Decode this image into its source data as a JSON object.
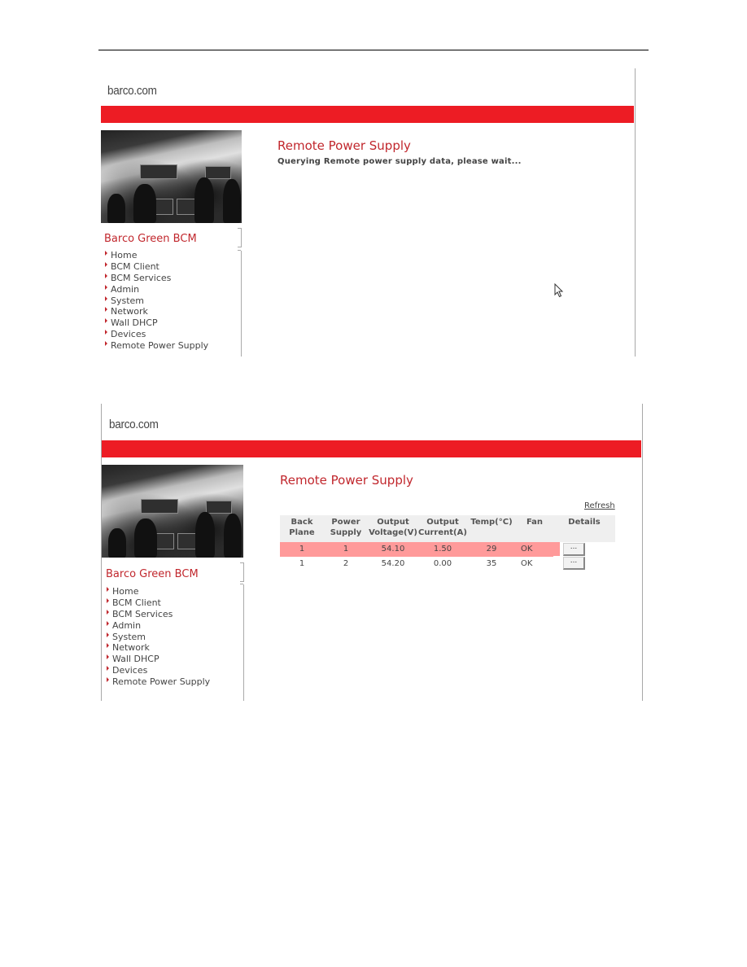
{
  "screenshot_loading": {
    "brand": "barco.com",
    "sidebar": {
      "title": "Barco Green BCM",
      "items": [
        {
          "label": "Home"
        },
        {
          "label": "BCM Client"
        },
        {
          "label": "BCM Services"
        },
        {
          "label": "Admin"
        },
        {
          "label": "System"
        },
        {
          "label": "Network"
        },
        {
          "label": "Wall DHCP"
        },
        {
          "label": "Devices"
        },
        {
          "label": "Remote Power Supply"
        }
      ]
    },
    "main": {
      "title": "Remote Power Supply",
      "status": "Querying Remote power supply data, please wait..."
    }
  },
  "screenshot_results": {
    "brand": "barco.com",
    "sidebar": {
      "title": "Barco Green BCM",
      "items": [
        {
          "label": "Home"
        },
        {
          "label": "BCM Client"
        },
        {
          "label": "BCM Services"
        },
        {
          "label": "Admin"
        },
        {
          "label": "System"
        },
        {
          "label": "Network"
        },
        {
          "label": "Wall DHCP"
        },
        {
          "label": "Devices"
        },
        {
          "label": "Remote Power Supply"
        }
      ]
    },
    "main": {
      "title": "Remote Power Supply",
      "refresh_label": "Refresh",
      "table": {
        "headers": [
          {
            "line1": "Back",
            "line2": "Plane"
          },
          {
            "line1": "Power",
            "line2": "Supply"
          },
          {
            "line1": "Output",
            "line2": "Voltage(V)"
          },
          {
            "line1": "Output",
            "line2": "Current(A)"
          },
          {
            "line1": "Temp(°C)",
            "line2": ""
          },
          {
            "line1": "Fan",
            "line2": ""
          },
          {
            "line1": "Details",
            "line2": ""
          }
        ],
        "rows": [
          {
            "back_plane": "1",
            "power_supply": "1",
            "voltage": "54.10",
            "current": "1.50",
            "temp": "29",
            "fan": "OK",
            "details": "...",
            "highlighted": true
          },
          {
            "back_plane": "1",
            "power_supply": "2",
            "voltage": "54.20",
            "current": "0.00",
            "temp": "35",
            "fan": "OK",
            "details": "...",
            "highlighted": false
          }
        ]
      }
    }
  },
  "colors": {
    "brand_red": "#ed1c24",
    "title_red": "#c1272d",
    "row_highlight": "#ff9a9a"
  }
}
